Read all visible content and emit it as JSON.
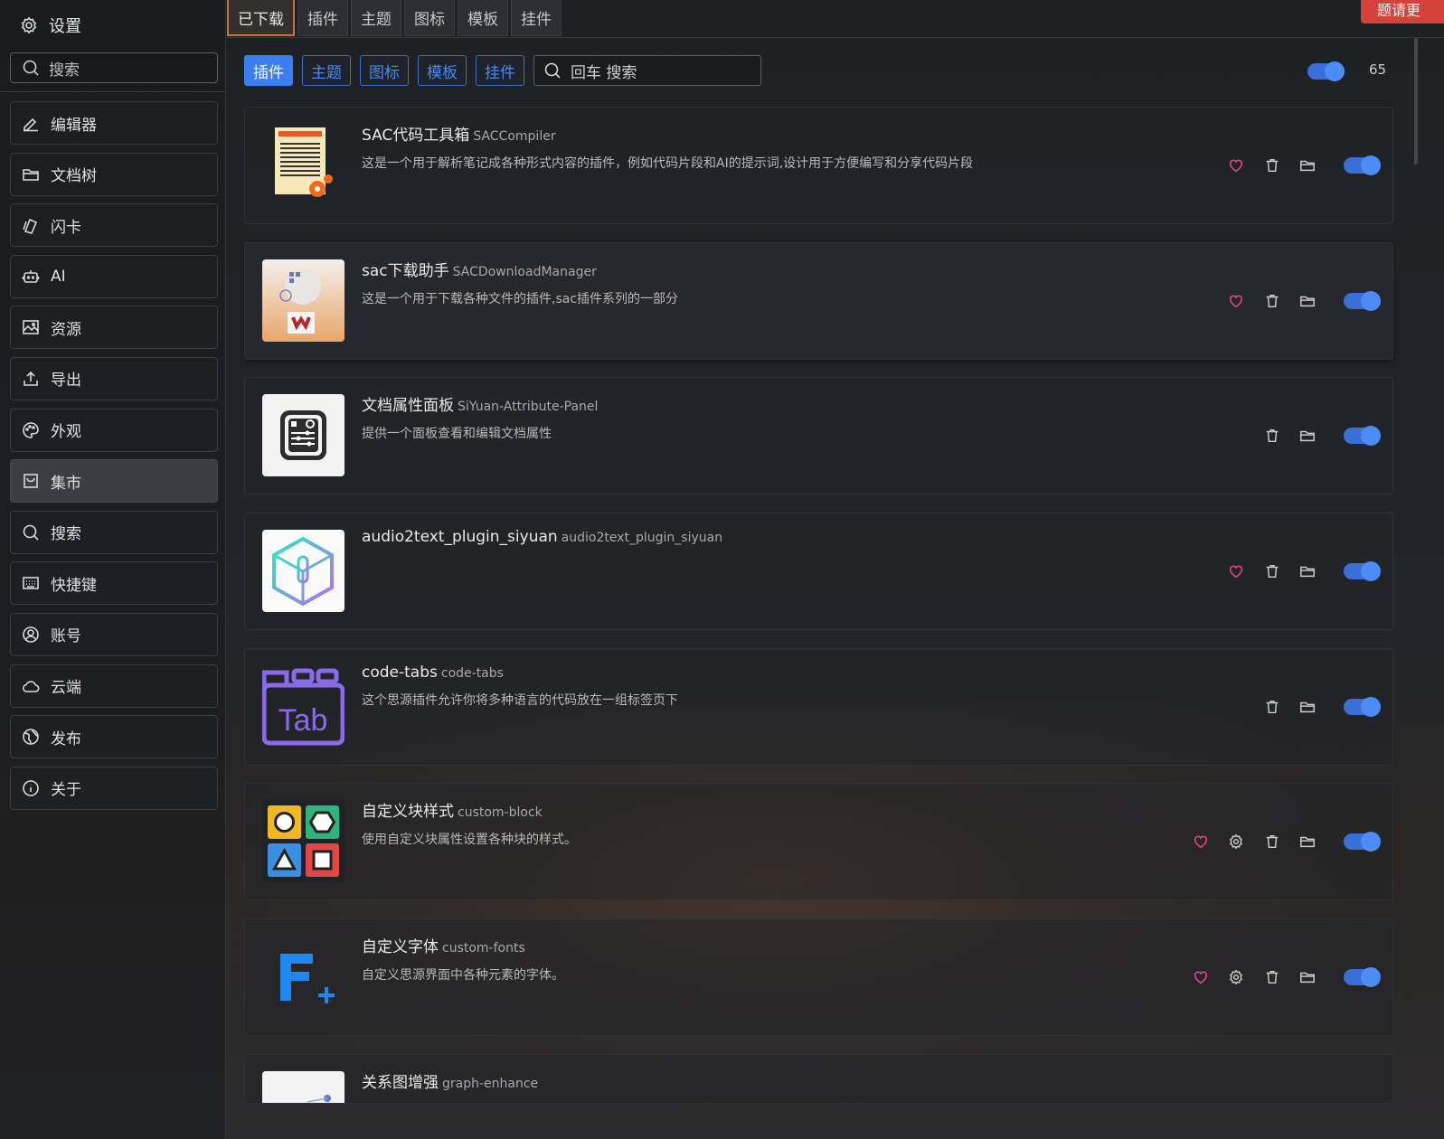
{
  "sidebar": {
    "title": "设置",
    "search_placeholder": "搜索",
    "items": [
      {
        "label": "编辑器",
        "icon": "edit-icon"
      },
      {
        "label": "文档树",
        "icon": "folder-icon"
      },
      {
        "label": "闪卡",
        "icon": "flashcard-icon"
      },
      {
        "label": "AI",
        "icon": "robot-icon"
      },
      {
        "label": "资源",
        "icon": "image-icon"
      },
      {
        "label": "导出",
        "icon": "upload-icon"
      },
      {
        "label": "外观",
        "icon": "palette-icon"
      },
      {
        "label": "集市",
        "icon": "bazaar-icon",
        "active": true
      },
      {
        "label": "搜索",
        "icon": "search-icon"
      },
      {
        "label": "快捷键",
        "icon": "keyboard-icon"
      },
      {
        "label": "账号",
        "icon": "account-icon"
      },
      {
        "label": "云端",
        "icon": "cloud-icon"
      },
      {
        "label": "发布",
        "icon": "globe-icon"
      },
      {
        "label": "关于",
        "icon": "info-icon"
      }
    ]
  },
  "top_tabs": [
    "已下载",
    "插件",
    "主题",
    "图标",
    "模板",
    "挂件"
  ],
  "red_button": "题请更",
  "filters": {
    "buttons": [
      "插件",
      "主题",
      "图标",
      "模板",
      "挂件"
    ],
    "search_placeholder": "回车 搜索",
    "count": "65"
  },
  "colors": {
    "accent": "#3b7ef2",
    "heart": "#e0458a",
    "tab_active_border": "#c8743e",
    "red": "#d4423a"
  },
  "plugins": [
    {
      "name": "SAC代码工具箱",
      "id": "SACCompiler",
      "desc": "这是一个用于解析笔记成各种形式内容的插件，例如代码片段和AI的提示词,设计用于方便编写和分享代码片段",
      "heart": true,
      "settings": false
    },
    {
      "name": "sac下载助手",
      "id": "SACDownloadManager",
      "desc": "这是一个用于下载各种文件的插件,sac插件系列的一部分",
      "heart": true,
      "settings": false
    },
    {
      "name": "文档属性面板",
      "id": "SiYuan-Attribute-Panel",
      "desc": "提供一个面板查看和编辑文档属性",
      "heart": false,
      "settings": false
    },
    {
      "name": "audio2text_plugin_siyuan",
      "id": "audio2text_plugin_siyuan",
      "desc": "",
      "heart": true,
      "settings": false
    },
    {
      "name": "code-tabs",
      "id": "code-tabs",
      "desc": "这个思源插件允许你将多种语言的代码放在一组标签页下",
      "heart": false,
      "settings": false
    },
    {
      "name": "自定义块样式",
      "id": "custom-block",
      "desc": "使用自定义块属性设置各种块的样式。",
      "heart": true,
      "settings": true
    },
    {
      "name": "自定义字体",
      "id": "custom-fonts",
      "desc": "自定义思源界面中各种元素的字体。",
      "heart": true,
      "settings": true
    },
    {
      "name": "关系图增强",
      "id": "graph-enhance",
      "desc": "",
      "heart": false,
      "settings": false
    }
  ]
}
